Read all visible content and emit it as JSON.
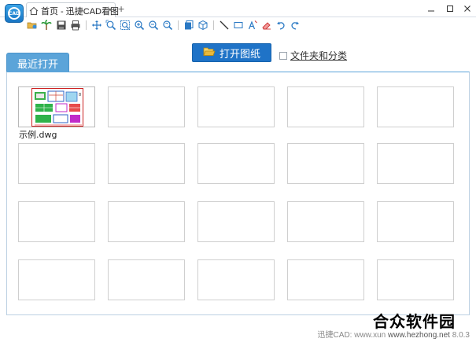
{
  "window": {
    "tab_title": "首页 - 迅捷CAD看图",
    "tab_close": "×",
    "new_tab": "+",
    "controls": {
      "minimize": "—",
      "maximize": "□",
      "close": "×"
    }
  },
  "toolbar": {
    "groups": [
      [
        "open-icon",
        "palm-icon",
        "save-icon",
        "print-icon"
      ],
      [
        "pan-icon",
        "zoom-window-icon",
        "zoom-extents-icon",
        "zoom-in-icon",
        "zoom-out-icon",
        "zoom-previous-icon"
      ],
      [
        "layers-icon",
        "3d-view-icon"
      ],
      [
        "line-measure-icon",
        "area-measure-icon",
        "text-icon",
        "erase-icon",
        "undo-icon",
        "redo-icon"
      ]
    ]
  },
  "main": {
    "open_button": "打开图纸",
    "folder_checkbox_label": "文件夹和分类",
    "folder_checkbox_checked": false,
    "recent_tab": "最近打开",
    "recent_files": [
      {
        "name": "示例.dwg",
        "has_preview": true
      }
    ],
    "grid": {
      "rows": 4,
      "cols": 5
    }
  },
  "footer": {
    "text": "迅捷CAD: www.xun",
    "version": "8.0.3"
  },
  "watermark": {
    "text": "合众软件园",
    "url_text": "www.hezhong.net"
  },
  "colors": {
    "accent": "#1f73c7",
    "tab_blue": "#5ba4d9"
  }
}
